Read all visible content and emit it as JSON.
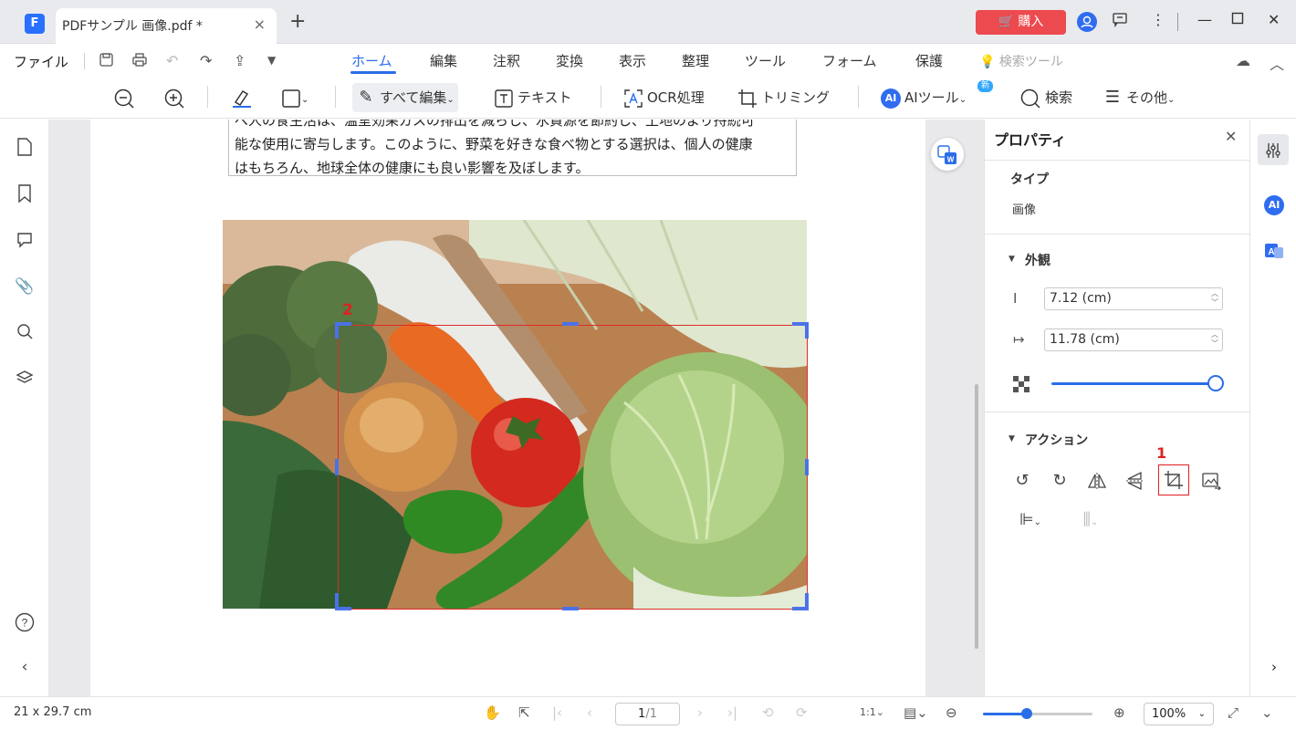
{
  "app": {
    "logo_letter": "F"
  },
  "tab": {
    "title": "PDFサンプル 画像.pdf *",
    "close_glyph": "×",
    "new_glyph": "+"
  },
  "titlebar": {
    "buy_label": "🛒 購入"
  },
  "menu": {
    "file_label": "ファイル",
    "tabs": [
      {
        "label": "ホーム"
      },
      {
        "label": "編集"
      },
      {
        "label": "注釈"
      },
      {
        "label": "変換"
      },
      {
        "label": "表示"
      },
      {
        "label": "整理"
      },
      {
        "label": "ツール"
      },
      {
        "label": "フォーム"
      },
      {
        "label": "保護"
      }
    ],
    "search_tools_label": "💡 検索ツール"
  },
  "toolbar": {
    "edit_all_label": "すべて編集",
    "text_label": "テキスト",
    "ocr_label": "OCR処理",
    "trim_label": "トリミング",
    "ai_tool_label": "AIツール",
    "ai_badge": "新",
    "search_label": "検索",
    "more_label": "その他"
  },
  "document": {
    "text_lines": [
      "べ人の食生活は、温室効果ガスの排出を減らし、水資源を節約し、土地のより持続可",
      "能な使用に寄与します。このように、野菜を好きな食べ物とする選択は、個人の健康",
      "はもちろん、地球全体の健康にも良い影響を及ぼします。"
    ]
  },
  "annotations": {
    "label_1": "1",
    "label_2": "2"
  },
  "properties": {
    "title": "プロパティ",
    "type_heading": "タイプ",
    "type_value": "画像",
    "appearance_heading": "外観",
    "height_value": "7.12 (cm)",
    "width_value": "11.78 (cm)",
    "opacity_percent": 100,
    "actions_heading": "アクション"
  },
  "statusbar": {
    "page_size": "21 x 29.7 cm",
    "current_page": "1",
    "total_pages": "/1",
    "zoom": "100%"
  },
  "colors": {
    "accent": "#2b6de8",
    "buy": "#ec4a4f",
    "annotation_red": "#e02020"
  }
}
